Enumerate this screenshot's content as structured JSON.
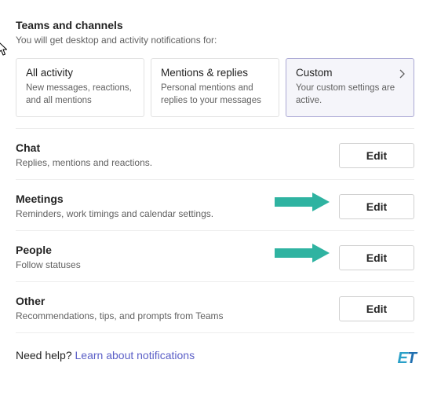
{
  "teams": {
    "title": "Teams and channels",
    "desc": "You will get desktop and activity notifications for:",
    "options": {
      "all": {
        "title": "All activity",
        "desc": "New messages, reactions, and all mentions"
      },
      "mentions": {
        "title": "Mentions & replies",
        "desc": "Personal mentions and replies to your messages"
      },
      "custom": {
        "title": "Custom",
        "desc": "Your custom settings are active."
      }
    }
  },
  "rows": {
    "chat": {
      "title": "Chat",
      "desc": "Replies, mentions and reactions.",
      "btn": "Edit"
    },
    "meetings": {
      "title": "Meetings",
      "desc": "Reminders, work timings and calendar settings.",
      "btn": "Edit"
    },
    "people": {
      "title": "People",
      "desc": "Follow statuses",
      "btn": "Edit"
    },
    "other": {
      "title": "Other",
      "desc": "Recommendations, tips, and prompts from Teams",
      "btn": "Edit"
    }
  },
  "help": {
    "prefix": "Need help? ",
    "link": "Learn about notifications"
  },
  "wm": {
    "e": "E",
    "t": "T"
  }
}
